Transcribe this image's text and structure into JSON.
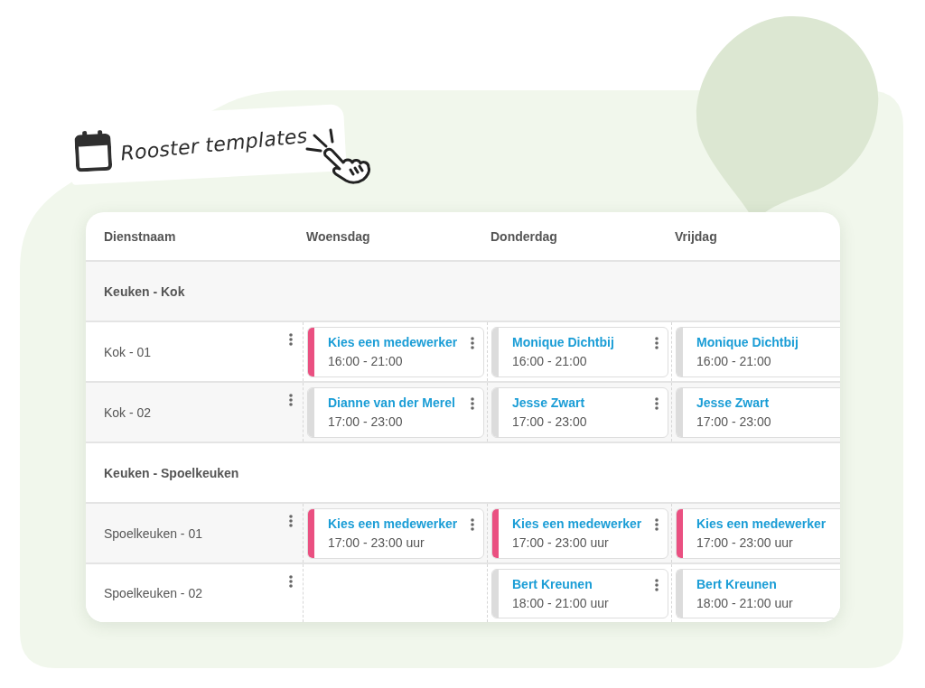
{
  "title_card": {
    "title": "Rooster templates"
  },
  "table": {
    "columns": [
      "Dienstnaam",
      "Woensdag",
      "Donderdag",
      "Vrijdag"
    ],
    "rows": [
      {
        "kind": "group",
        "label": "Keuken - Kok"
      },
      {
        "kind": "service",
        "label": "Kok - 01",
        "cells": [
          {
            "kind": "shift",
            "employee": "Kies een medewerker",
            "time": "16:00 - 21:00",
            "assigned": false,
            "menu": true
          },
          {
            "kind": "shift",
            "employee": "Monique Dichtbij",
            "time": "16:00 - 21:00",
            "assigned": true,
            "menu": true
          },
          {
            "kind": "shift",
            "employee": "Monique Dichtbij",
            "time": "16:00 - 21:00",
            "assigned": true,
            "menu": false
          }
        ]
      },
      {
        "kind": "service",
        "label": "Kok - 02",
        "cells": [
          {
            "kind": "shift",
            "employee": "Dianne van der Merel",
            "time": "17:00 - 23:00",
            "assigned": true,
            "menu": true
          },
          {
            "kind": "shift",
            "employee": "Jesse Zwart",
            "time": "17:00 - 23:00",
            "assigned": true,
            "menu": true
          },
          {
            "kind": "shift",
            "employee": "Jesse Zwart",
            "time": "17:00 - 23:00",
            "assigned": true,
            "menu": false
          }
        ]
      },
      {
        "kind": "group",
        "label": "Keuken - Spoelkeuken"
      },
      {
        "kind": "service",
        "label": "Spoelkeuken - 01",
        "cells": [
          {
            "kind": "shift",
            "employee": "Kies een medewerker",
            "time": "17:00 - 23:00 uur",
            "assigned": false,
            "menu": true
          },
          {
            "kind": "shift",
            "employee": "Kies een medewerker",
            "time": "17:00 - 23:00 uur",
            "assigned": false,
            "menu": true
          },
          {
            "kind": "shift",
            "employee": "Kies een medewerker",
            "time": "17:00 - 23:00 uur",
            "assigned": false,
            "menu": false
          }
        ]
      },
      {
        "kind": "service",
        "label": "Spoelkeuken - 02",
        "cells": [
          {
            "kind": "empty"
          },
          {
            "kind": "shift",
            "employee": "Bert Kreunen",
            "time": "18:00 - 21:00 uur",
            "assigned": true,
            "menu": true
          },
          {
            "kind": "shift",
            "employee": "Bert Kreunen",
            "time": "18:00 - 21:00 uur",
            "assigned": true,
            "menu": false
          }
        ]
      }
    ]
  }
}
